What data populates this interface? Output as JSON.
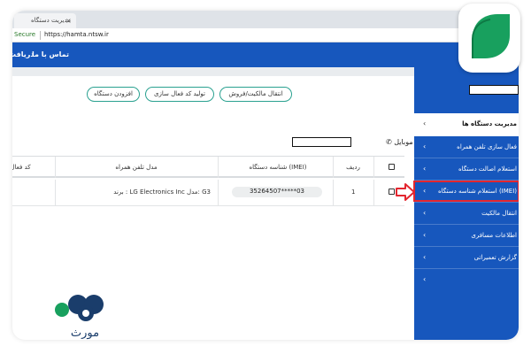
{
  "browser": {
    "tab_title": "مدیریت دستگاه",
    "security_label": "Secure",
    "url": "https://hamta.ntsw.ir"
  },
  "navbar": {
    "items": [
      "تماس با ما",
      "دریافت"
    ]
  },
  "actions": {
    "buttons": [
      "انتقال مالکیت/فروش",
      "تولید کد فعال سازی",
      "افزودن دستگاه"
    ]
  },
  "phone_section": {
    "label": "شماره موبایل"
  },
  "table": {
    "headers": [
      "ردیف",
      "شناسه دستگاه (IMEI)",
      "مدل تلفن همراه",
      "کد فعال"
    ],
    "rows": [
      {
        "index": "1",
        "imei": "35264507*****03",
        "model": "برند : LG Electronics Inc مدل: G3"
      }
    ]
  },
  "sidebar": {
    "header": "مدیریت دستگاه ها",
    "items": [
      "فعال سازی تلفن همراه",
      "استعلام اصالت دستگاه",
      "استعلام شناسه دستگاه (IMEI)",
      "انتقال مالکیت",
      "اطلاعات مسافری",
      "گزارش تعمیراتی"
    ],
    "highlighted_index": 2
  },
  "colors": {
    "primary": "#1757bd",
    "accent_teal": "#2aa190",
    "highlight_red": "#e3262f",
    "logo_green": "#18a05e"
  },
  "branding": {
    "watermark": "مورث"
  }
}
